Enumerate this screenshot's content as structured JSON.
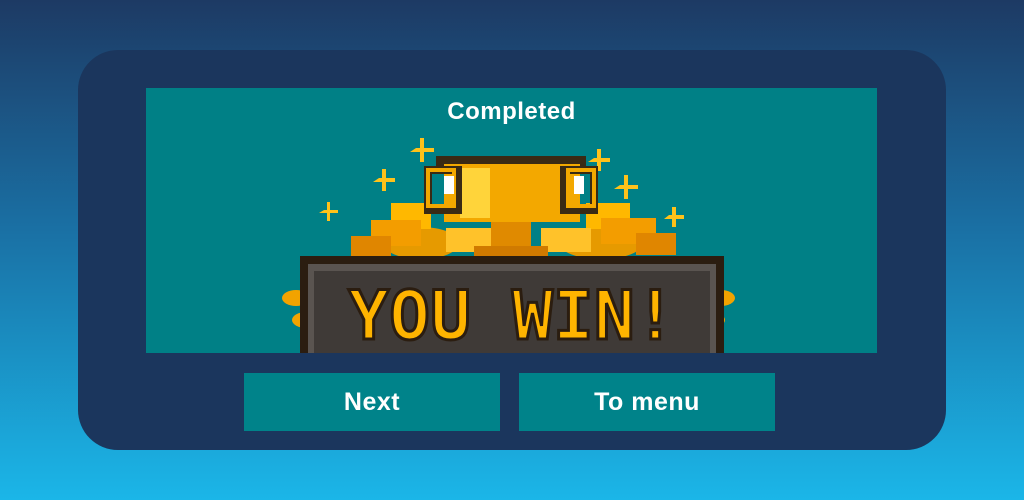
{
  "dialog": {
    "title": "Completed",
    "banner_text": "YOU WIN!",
    "next_label": "Next",
    "menu_label": "To menu"
  },
  "colors": {
    "panel": "#1b365d",
    "stage": "#008086",
    "button": "#00838a",
    "gold": "#f5b400"
  },
  "icons": {
    "trophy": "trophy-icon",
    "sparkle": "sparkle-icon",
    "laurel": "laurel-icon"
  }
}
